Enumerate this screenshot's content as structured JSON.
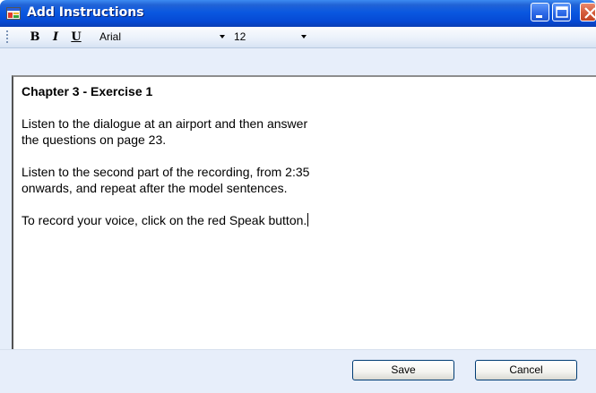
{
  "window": {
    "title": "Add Instructions",
    "controls": [
      "minimize-icon",
      "maximize-icon",
      "close-icon"
    ]
  },
  "toolbar": {
    "bold_label": "B",
    "italic_label": "I",
    "underline_label": "U",
    "font_family": "Arial",
    "font_size": "12"
  },
  "editor": {
    "heading": "Chapter 3 - Exercise 1",
    "lines": [
      "Listen to the dialogue at an airport and then answer",
      "the questions on page 23.",
      "Listen to the second part of the recording, from 2:35",
      "onwards, and repeat after the model sentences.",
      "To record your voice, click on the red Speak button."
    ]
  },
  "footer": {
    "save_label": "Save",
    "cancel_label": "Cancel"
  },
  "colors": {
    "titlebar": "#0a58e0",
    "toolbar": "#e9f0fa",
    "footer": "#e7eefa",
    "close_button": "#d35a3a"
  }
}
